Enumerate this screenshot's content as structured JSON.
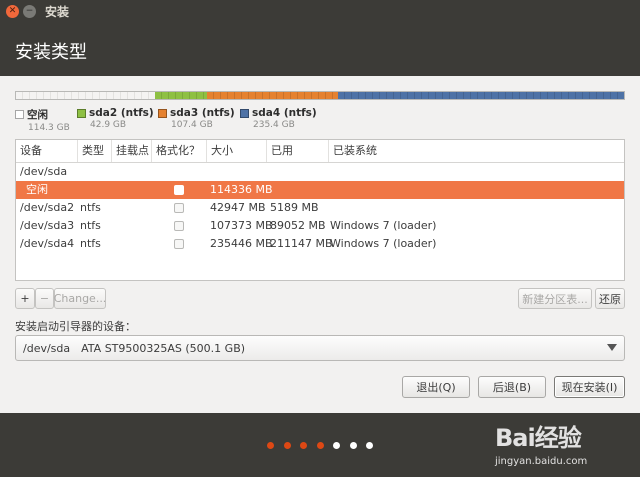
{
  "window": {
    "title": "安装"
  },
  "header": {
    "title": "安装类型"
  },
  "partition_bar": {
    "segments": [
      {
        "name": "空闲",
        "color": "#f0efee",
        "fraction": 0.2286
      },
      {
        "name": "sda2 (ntfs)",
        "color": "#8ec043",
        "fraction": 0.0859
      },
      {
        "name": "sda3 (ntfs)",
        "color": "#e5812f",
        "fraction": 0.2147
      },
      {
        "name": "sda4 (ntfs)",
        "color": "#4e72a6",
        "fraction": 0.4708
      }
    ]
  },
  "legend": [
    {
      "label": "空闲",
      "size": "114.3 GB",
      "color": "#ffffff"
    },
    {
      "label": "sda2 (ntfs)",
      "size": "42.9 GB",
      "color": "#8ec043"
    },
    {
      "label": "sda3 (ntfs)",
      "size": "107.4 GB",
      "color": "#e5812f"
    },
    {
      "label": "sda4 (ntfs)",
      "size": "235.4 GB",
      "color": "#4e72a6"
    }
  ],
  "table": {
    "columns": [
      "设备",
      "类型",
      "挂载点",
      "格式化？",
      "大小",
      "已用",
      "已装系统"
    ],
    "device": "/dev/sda",
    "rows": [
      {
        "device": "空闲",
        "type": "",
        "mount": "",
        "size": "114336 MB",
        "used": "",
        "system": "",
        "selected": true
      },
      {
        "device": "/dev/sda2",
        "type": "ntfs",
        "mount": "",
        "size": "42947 MB",
        "used": "5189 MB",
        "system": "",
        "selected": false
      },
      {
        "device": "/dev/sda3",
        "type": "ntfs",
        "mount": "",
        "size": "107373 MB",
        "used": "89052 MB",
        "system": "Windows 7 (loader)",
        "selected": false
      },
      {
        "device": "/dev/sda4",
        "type": "ntfs",
        "mount": "",
        "size": "235446 MB",
        "used": "211147 MB",
        "system": "Windows 7 (loader)",
        "selected": false
      }
    ]
  },
  "controls": {
    "add": "+",
    "remove": "−",
    "change": "Change...",
    "new_table": "新建分区表...",
    "revert": "还原"
  },
  "bootloader": {
    "label": "安装启动引导器的设备：",
    "device": "/dev/sda",
    "description": "ATA ST9500325AS (500.1 GB)"
  },
  "actions": {
    "quit": "退出(Q)",
    "back": "后退(B)",
    "install": "现在安装(I)"
  },
  "progress": {
    "total_steps": 7,
    "current_step": 4
  },
  "watermark": {
    "main": "Bai经验",
    "url": "jingyan.baidu.com"
  }
}
